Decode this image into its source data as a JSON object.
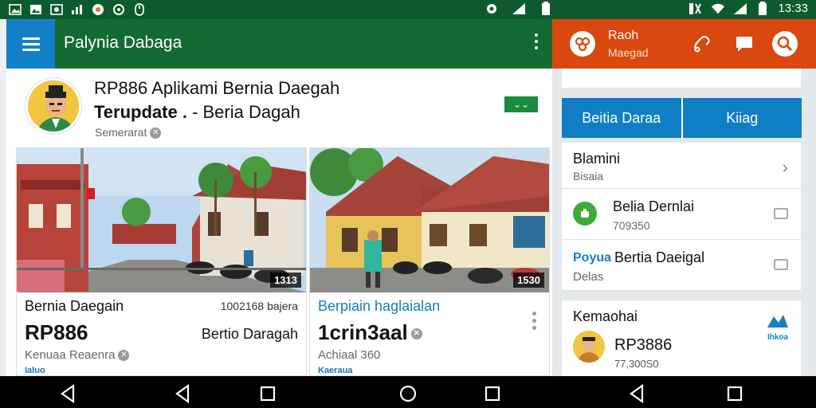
{
  "status_bar": {
    "time": "13:33"
  },
  "left_app": {
    "title": "Palynia Dabaga",
    "post": {
      "title_line1": "RP886 Aplikami Bernia Daegah",
      "title_line2_bold": "Terupdate .",
      "title_line2_rest": " - Beria Dagah",
      "meta": "Semerarat"
    },
    "cards": [
      {
        "image_tag": "1313",
        "name": "Bernia Daegain",
        "side_text": "1002168 bajera",
        "price": "RP886",
        "side_text2": "Bertio Daragah",
        "sub": "Kenuaa Reaenra",
        "foot": "Ialuo"
      },
      {
        "image_tag": "1530",
        "name": "Berpiain haglaialan",
        "price": "1crin3aal",
        "sub": "Achiaal 360",
        "foot": "Kaeraua"
      }
    ]
  },
  "right_app": {
    "header_title": "Raoh",
    "header_sub": "Maegad",
    "tabs": [
      "Beitia Daraa",
      "Kiiag"
    ],
    "list": [
      {
        "title": "Blamini",
        "sub": "Bisaia"
      },
      {
        "title": "Belia Dernlai",
        "sub": "709350"
      },
      {
        "prefix": "Poyua",
        "title": "Bertia Daeigal",
        "sub": "Delas"
      }
    ],
    "card": {
      "heading": "Kemaohai",
      "logo_text": "Ihkoa",
      "price": "RP3886",
      "sub": "77,300S0"
    }
  }
}
